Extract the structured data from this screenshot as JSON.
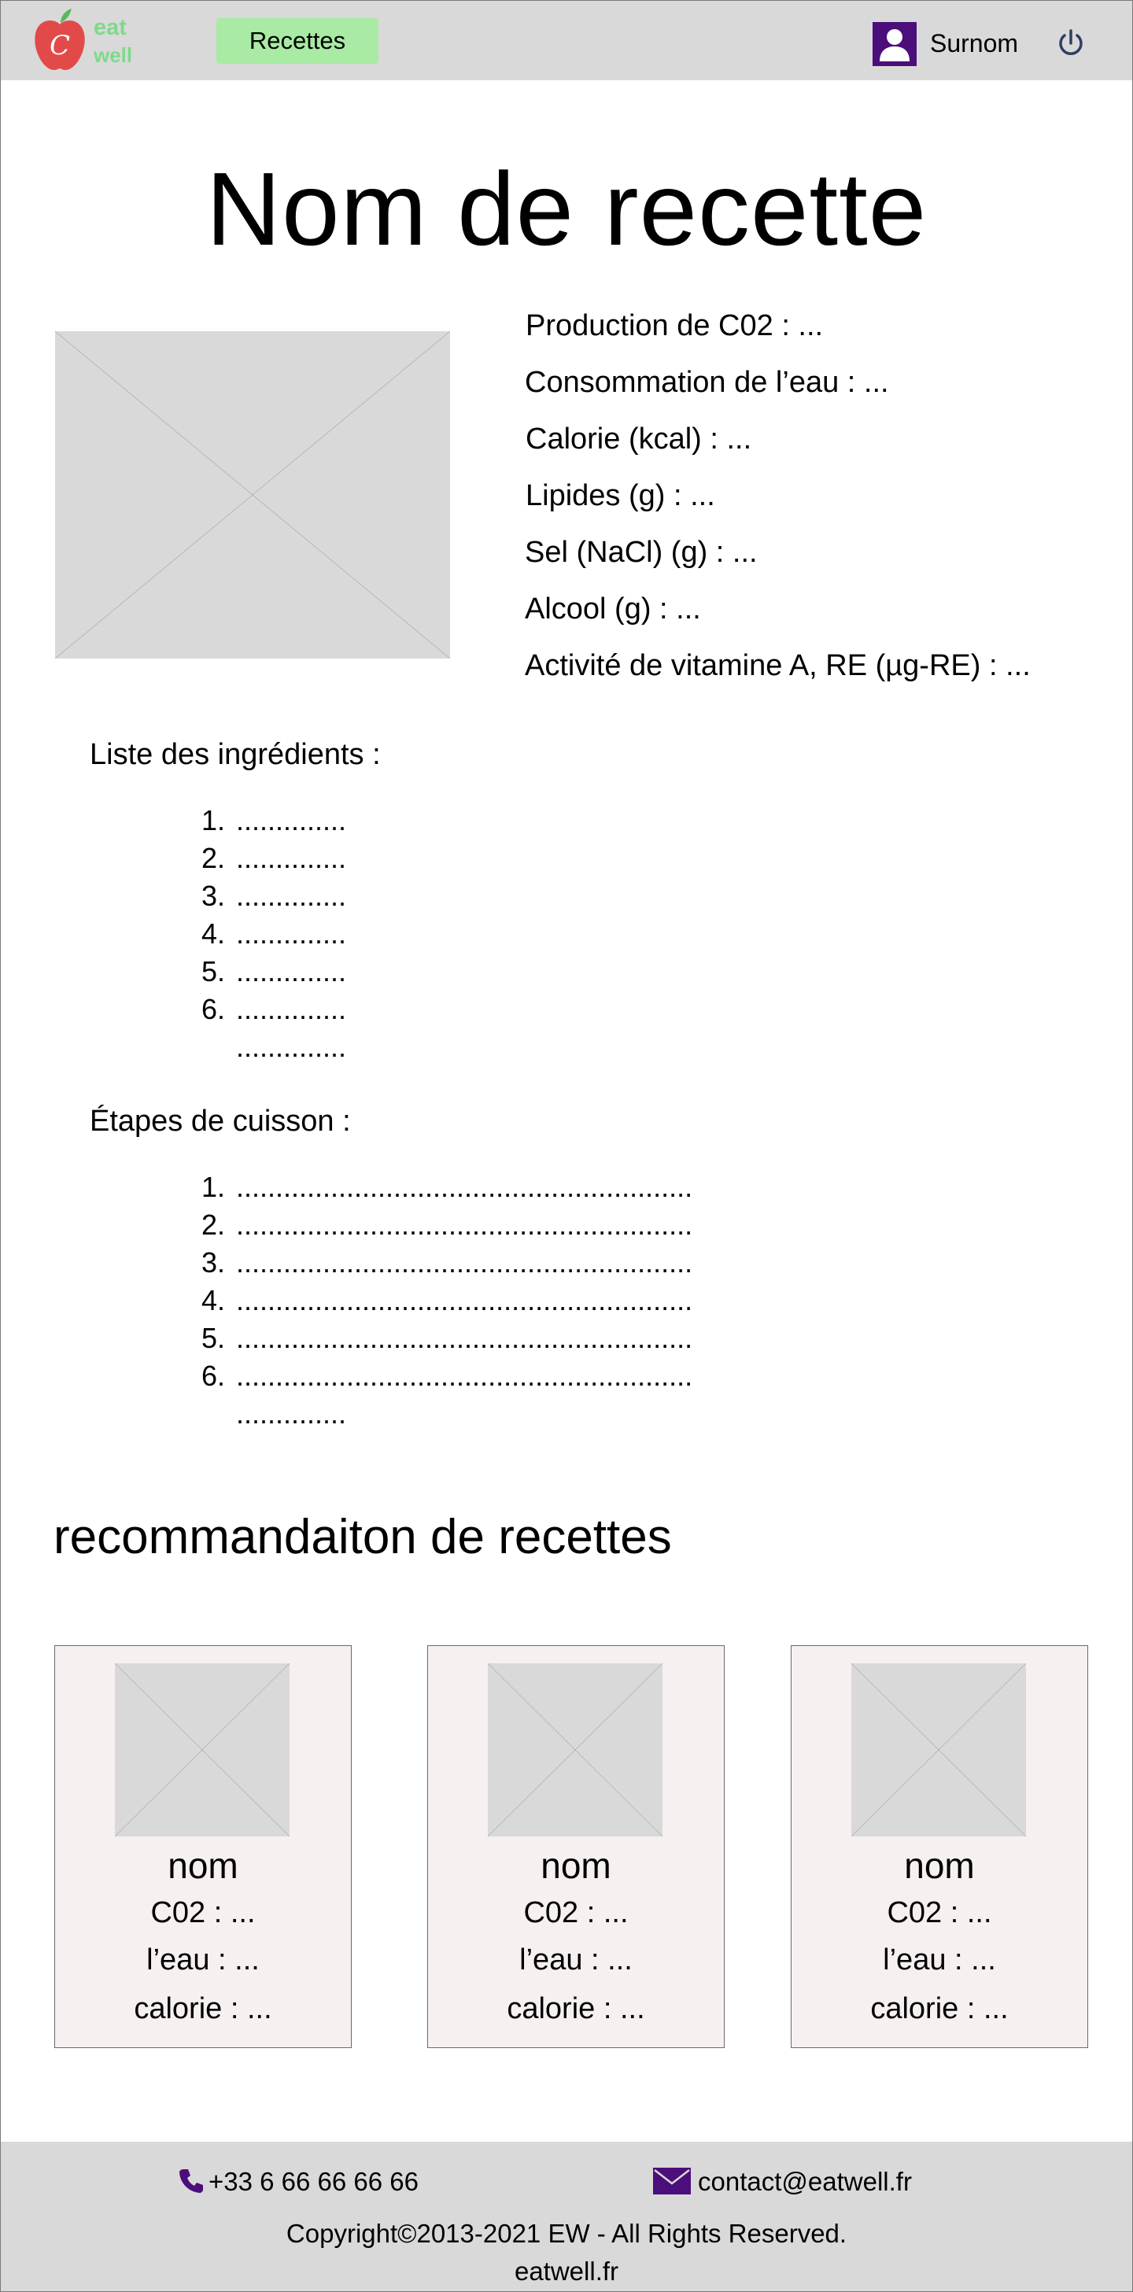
{
  "header": {
    "logo_text_1": "eat",
    "logo_text_2": "well",
    "nav_recipes_label": "Recettes",
    "username": "Surnom",
    "accent_color": "#4b0e7a",
    "nav_color": "#a9eaa4"
  },
  "recipe": {
    "title": "Nom de recette",
    "nutrition": [
      "Production de C02 : ...",
      "Consommation de l’eau : ...",
      "Calorie (kcal) : ...",
      "Lipides (g) : ...",
      "Sel (NaCl) (g) : ...",
      "Alcool (g) : ...",
      "Activité de vitamine A, RE (µg-RE) : ..."
    ],
    "ingredients_label": "Liste des ingrédients :",
    "ingredients": [
      {
        "num": "1.",
        "text": ".............."
      },
      {
        "num": "2.",
        "text": ".............."
      },
      {
        "num": "3.",
        "text": ".............."
      },
      {
        "num": "4.",
        "text": ".............."
      },
      {
        "num": "5.",
        "text": ".............."
      },
      {
        "num": "6.",
        "text": ".............."
      },
      {
        "num": "",
        "text": ".............."
      }
    ],
    "steps_label": "Étapes de cuisson :",
    "steps": [
      {
        "num": "1.",
        "text": ".........................................................."
      },
      {
        "num": "2.",
        "text": ".........................................................."
      },
      {
        "num": "3.",
        "text": ".........................................................."
      },
      {
        "num": "4.",
        "text": ".........................................................."
      },
      {
        "num": "5.",
        "text": ".........................................................."
      },
      {
        "num": "6.",
        "text": ".........................................................."
      },
      {
        "num": "",
        "text": ".............."
      }
    ]
  },
  "recommendations": {
    "title": "recommandaiton de  recettes",
    "cards": [
      {
        "name": "nom",
        "co2": "C02 : ...",
        "water": "l’eau : ...",
        "calorie": "calorie : ..."
      },
      {
        "name": "nom",
        "co2": "C02 : ...",
        "water": "l’eau : ...",
        "calorie": "calorie : ..."
      },
      {
        "name": "nom",
        "co2": "C02 : ...",
        "water": "l’eau : ...",
        "calorie": "calorie : ..."
      }
    ]
  },
  "footer": {
    "phone": "+33 6 66 66 66 66",
    "email": "contact@eatwell.fr",
    "copyright": "Copyright©2013-2021 EW - All Rights Reserved.",
    "site": "eatwell.fr"
  }
}
